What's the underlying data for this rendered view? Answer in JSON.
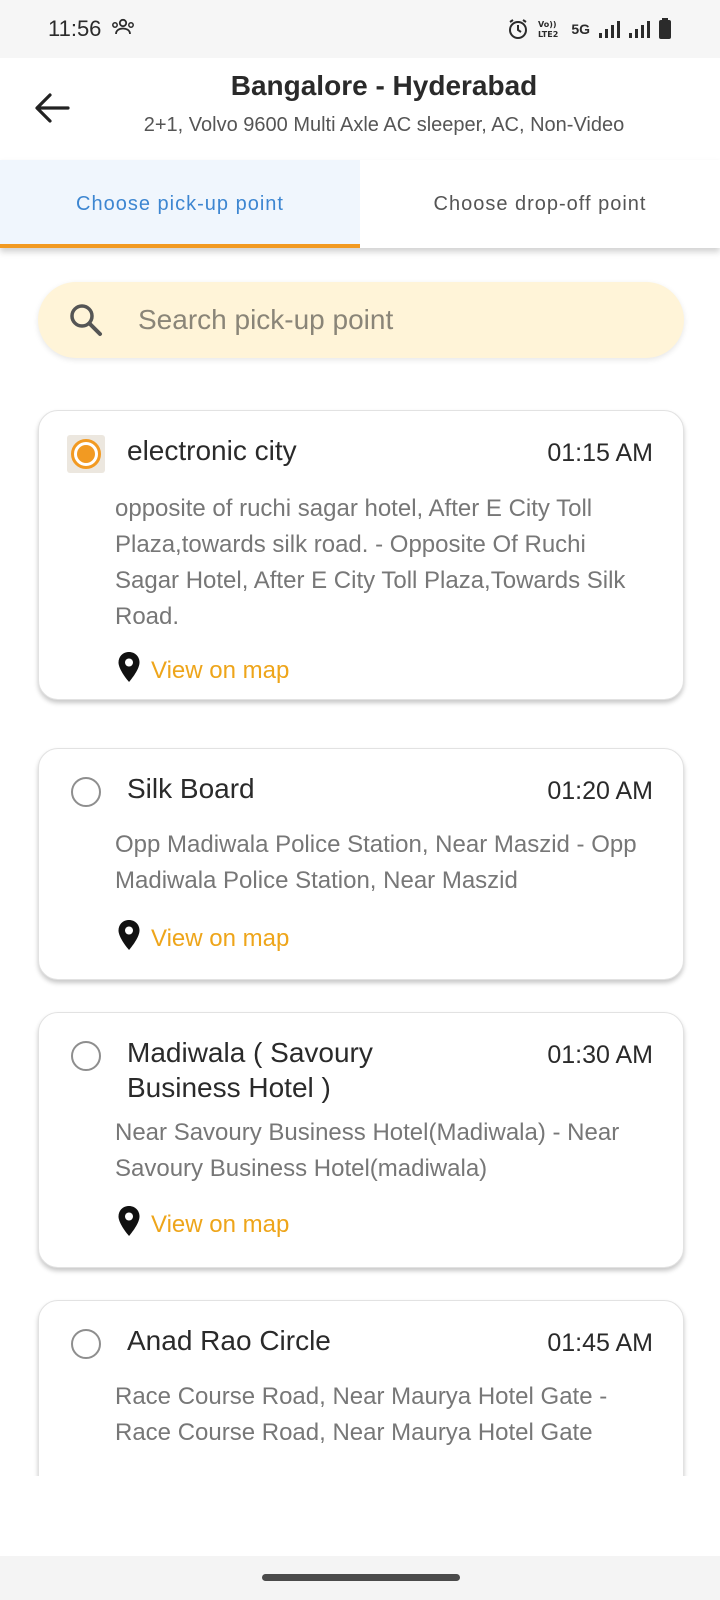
{
  "status_bar": {
    "time": "11:56",
    "network": "5G"
  },
  "header": {
    "title": "Bangalore - Hyderabad",
    "bus_info": "2+1, Volvo 9600 Multi Axle AC sleeper, AC, Non-Video"
  },
  "tabs": [
    {
      "label": "Choose pick-up point",
      "active": true
    },
    {
      "label": "Choose drop-off point",
      "active": false
    }
  ],
  "search": {
    "placeholder": "Search pick-up point",
    "value": ""
  },
  "stops": [
    {
      "name": "electronic city",
      "time": "01:15 AM",
      "address": "opposite of ruchi sagar hotel, After E City Toll Plaza,towards silk road. - Opposite Of Ruchi Sagar Hotel, After E City Toll Plaza,Towards Silk Road.",
      "map_label": "View on map",
      "selected": true
    },
    {
      "name": "Silk Board",
      "time": "01:20 AM",
      "address": "Opp Madiwala Police Station, Near Maszid - Opp Madiwala Police Station, Near Maszid",
      "map_label": "View on map",
      "selected": false
    },
    {
      "name": "Madiwala ( Savoury Business Hotel )",
      "time": "01:30 AM",
      "address": "Near Savoury Business Hotel(Madiwala) - Near Savoury Business Hotel(madiwala)",
      "map_label": "View on map",
      "selected": false
    },
    {
      "name": "Anad Rao Circle",
      "time": "01:45 AM",
      "address": "Race Course Road, Near Maurya Hotel Gate - Race Course Road, Near Maurya Hotel Gate",
      "map_label": "",
      "selected": false
    }
  ],
  "colors": {
    "accent_orange": "#f29a22",
    "link_yellow": "#eea51a",
    "tab_active_blue": "#3d86d1",
    "search_bg": "#fff4d8"
  }
}
